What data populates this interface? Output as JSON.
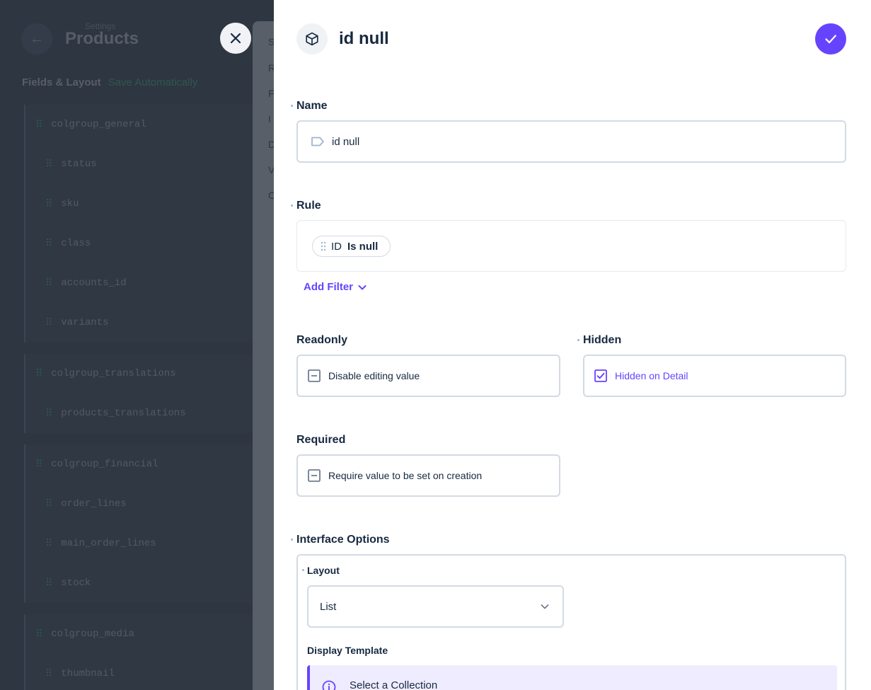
{
  "background": {
    "breadcrumb": "Settings",
    "title": "Products",
    "section_title": "Fields & Layout",
    "section_accent": "Save Automatically",
    "groups": [
      {
        "name": "colgroup_general",
        "fields": [
          "status",
          "sku",
          "class",
          "accounts_id",
          "variants"
        ]
      },
      {
        "name": "colgroup_translations",
        "fields": [
          "products_translations"
        ]
      },
      {
        "name": "colgroup_financial",
        "fields": [
          "order_lines",
          "main_order_lines",
          "stock"
        ]
      },
      {
        "name": "colgroup_media",
        "fields": [
          "thumbnail"
        ]
      }
    ],
    "panel_letters": [
      "S",
      "R",
      "F",
      "I",
      "D",
      "V",
      "C"
    ]
  },
  "drawer": {
    "title": "id null",
    "icon": "cube-icon",
    "name": {
      "label": "Name",
      "value": "id null",
      "icon": "tag-icon"
    },
    "rule": {
      "label": "Rule",
      "filter": {
        "field": "ID",
        "operator": "Is null"
      },
      "add_filter_label": "Add Filter"
    },
    "readonly": {
      "label": "Readonly",
      "text": "Disable editing value",
      "checked": false
    },
    "hidden": {
      "label": "Hidden",
      "text": "Hidden on Detail",
      "checked": true
    },
    "required": {
      "label": "Required",
      "text": "Require value to be set on creation",
      "checked": false
    },
    "interface_options": {
      "label": "Interface Options",
      "layout": {
        "label": "Layout",
        "value": "List"
      },
      "display_template": {
        "label": "Display Template",
        "notice": "Select a Collection"
      }
    }
  },
  "colors": {
    "accent": "#6644ff",
    "overlay": "#2e3642",
    "border": "#d3dae4",
    "text": "#172940"
  }
}
